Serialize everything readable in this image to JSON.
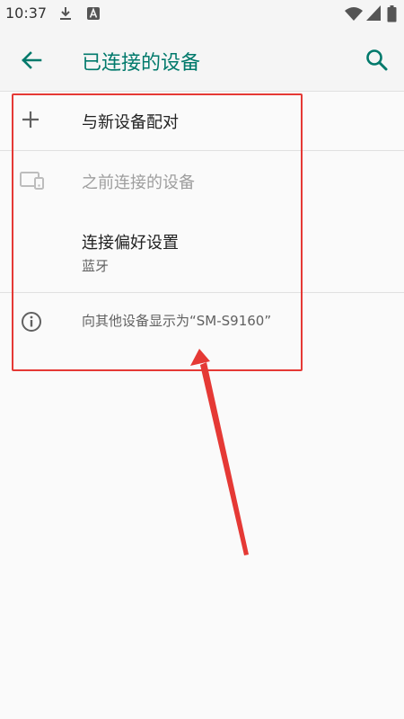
{
  "status_bar": {
    "time": "10:37",
    "icons": [
      "download-icon",
      "a-notification-icon",
      "wifi-icon",
      "signal-icon",
      "battery-icon"
    ]
  },
  "app_bar": {
    "title": "已连接的设备",
    "back_icon": "arrow-back-icon",
    "search_icon": "search-icon",
    "accent_color": "#00796b"
  },
  "rows": {
    "pair_new": {
      "label": "与新设备配对",
      "icon": "plus-icon"
    },
    "previous": {
      "label": "之前连接的设备",
      "icon": "devices-icon",
      "disabled": true
    },
    "preferences": {
      "label": "连接偏好设置",
      "summary": "蓝牙"
    },
    "visible_as": {
      "label": "向其他设备显示为“SM-S9160”",
      "icon": "info-icon"
    }
  },
  "annotation": {
    "highlight_color": "#e53935"
  }
}
